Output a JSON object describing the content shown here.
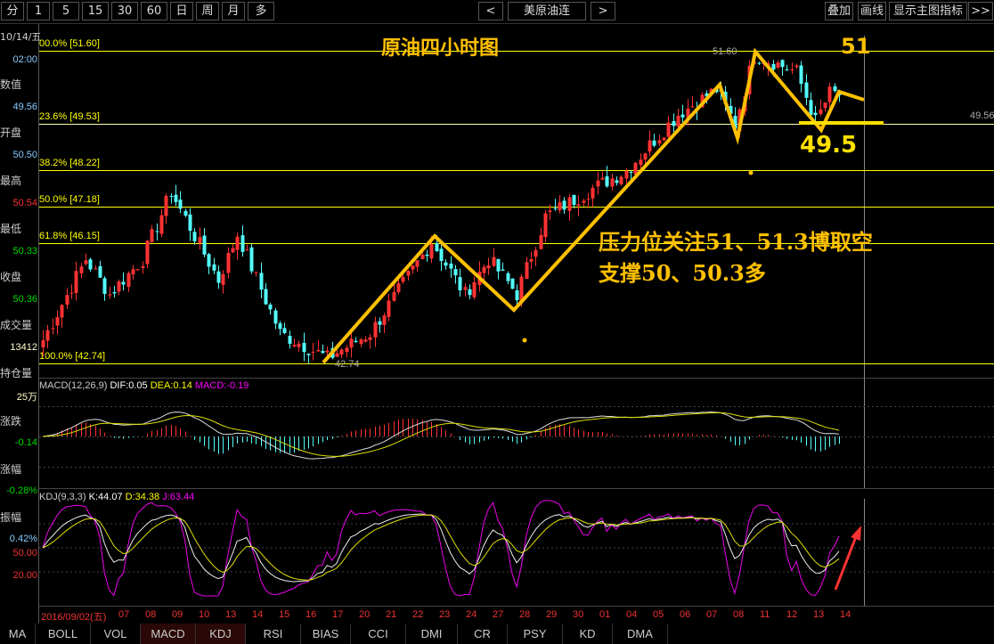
{
  "toolbar": {
    "periods": [
      "分",
      "1",
      "5",
      "15",
      "30",
      "60",
      "日",
      "周",
      "月",
      "多"
    ],
    "prev": "<",
    "symbol": "美原油连",
    "next": ">",
    "right": [
      "叠加",
      "画线",
      "显示主图指标",
      ">>"
    ]
  },
  "info": {
    "date": "10/14/五",
    "time": "02:00",
    "labels": {
      "value": "数值",
      "open": "开盘",
      "high": "最高",
      "low": "最低",
      "close": "收盘",
      "volume": "成交量",
      "oi": "持仓量"
    },
    "value": "49.56",
    "open": "50.50",
    "high": "50.54",
    "low": "50.33",
    "close": "50.36",
    "volume": "13412"
  },
  "macd_info": {
    "unit": "25万",
    "change": "涨跌",
    "change_val": "-0.14",
    "pct": "涨幅",
    "pct_val": "-0.28%"
  },
  "kdj_info": {
    "amp": "振幅",
    "amp_val": "0.42%",
    "l50": "50.00",
    "l20": "20.00"
  },
  "fib": [
    {
      "label": "00.0% [51.60]",
      "price": 51.6
    },
    {
      "label": "23.6% [49.53]",
      "price": 49.53
    },
    {
      "label": "38.2% [48.22]",
      "price": 48.22
    },
    {
      "label": "50.0% [47.18]",
      "price": 47.18
    },
    {
      "label": "61.8% [46.15]",
      "price": 46.15
    },
    {
      "label": "100.0% [42.74]",
      "price": 42.74
    }
  ],
  "price_marks": {
    "high": "51.60",
    "low": "42.74",
    "current": "49.56"
  },
  "macd_title": {
    "name": "MACD(12,26,9)",
    "dif": "DIF:0.05",
    "dea": "DEA:0.14",
    "macd": "MACD:-0.19"
  },
  "kdj_title": {
    "name": "KDJ(9,3,3)",
    "k": "K:44.07",
    "d": "D:34.38",
    "j": "J:63.44"
  },
  "annotations": {
    "title": "原油四小时图",
    "target": "51",
    "support_level": "49.5",
    "resist": "压力位关注51、51.3博取空",
    "support": "支撑50、50.3多"
  },
  "dates": [
    "2016/09/02(五)",
    "07",
    "08",
    "09",
    "10",
    "13",
    "14",
    "15",
    "16",
    "17",
    "20",
    "21",
    "22",
    "23",
    "24",
    "27",
    "28",
    "29",
    "30",
    "01",
    "04",
    "05",
    "06",
    "07",
    "08",
    "11",
    "12",
    "13",
    "14"
  ],
  "indicator_tabs": [
    "MA",
    "BOLL",
    "VOL",
    "MACD",
    "KDJ",
    "RSI",
    "BIAS",
    "CCI",
    "DMI",
    "CR",
    "PSY",
    "KD",
    "DMA"
  ],
  "chart_data": {
    "type": "candlestick",
    "ylim": [
      42.74,
      51.6
    ],
    "price_path": [
      [
        0,
        43.4
      ],
      [
        9,
        45.7
      ],
      [
        14,
        44.7
      ],
      [
        21,
        45.7
      ],
      [
        27,
        47.6
      ],
      [
        37,
        45.1
      ],
      [
        41,
        46.4
      ],
      [
        50,
        43.6
      ],
      [
        60,
        42.9
      ],
      [
        69,
        43.6
      ],
      [
        73,
        44.4
      ],
      [
        82,
        46.2
      ],
      [
        89,
        44.7
      ],
      [
        94,
        45.7
      ],
      [
        100,
        44.7
      ],
      [
        106,
        46.9
      ],
      [
        116,
        47.7
      ],
      [
        123,
        48.2
      ],
      [
        134,
        49.8
      ],
      [
        142,
        50.5
      ],
      [
        146,
        49.5
      ],
      [
        150,
        51.5
      ],
      [
        159,
        51.0
      ],
      [
        163,
        49.6
      ],
      [
        166,
        50.4
      ],
      [
        168,
        50.36
      ]
    ],
    "colors": {
      "up": "#ff3232",
      "down": "#54fcfc",
      "fib": "#ffff00",
      "annotation": "#ffc000"
    }
  }
}
